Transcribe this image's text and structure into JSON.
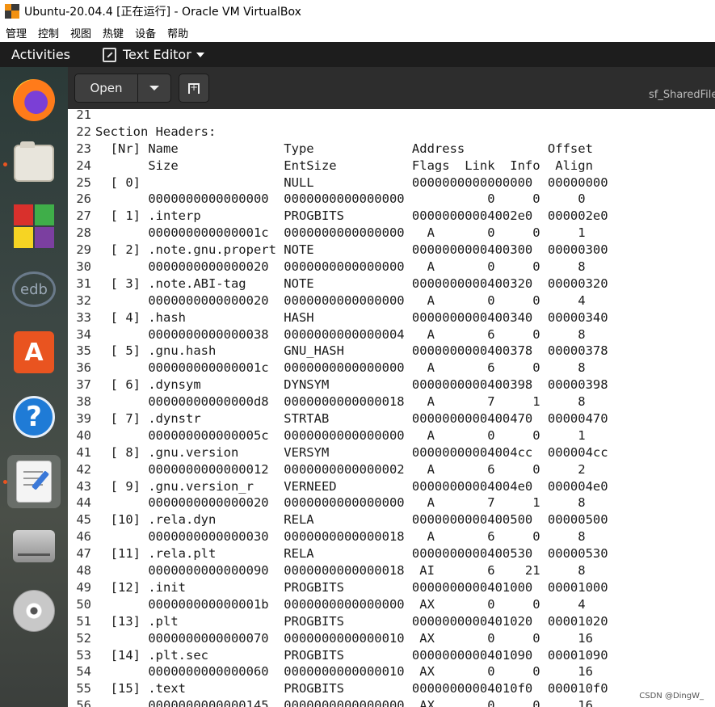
{
  "window": {
    "title": "Ubuntu-20.04.4 [正在运行] - Oracle VM VirtualBox",
    "menu": [
      "管理",
      "控制",
      "视图",
      "热键",
      "设备",
      "帮助"
    ]
  },
  "topbar": {
    "activities": "Activities",
    "app_name": "Text Editor"
  },
  "dock": [
    {
      "name": "firefox-icon"
    },
    {
      "name": "files-icon"
    },
    {
      "name": "libreoffice-icon"
    },
    {
      "name": "edb-icon",
      "text": "edb"
    },
    {
      "name": "software-store-icon"
    },
    {
      "name": "help-icon"
    },
    {
      "name": "text-editor-icon"
    },
    {
      "name": "drive-icon"
    },
    {
      "name": "cdrom-icon"
    }
  ],
  "editor": {
    "open_label": "Open",
    "tab_label": "sf_SharedFile",
    "lines": [
      {
        "n": "21",
        "t": ""
      },
      {
        "n": "22",
        "t": "Section Headers:"
      },
      {
        "n": "23",
        "t": "  [Nr] Name              Type             Address           Offset"
      },
      {
        "n": "24",
        "t": "       Size              EntSize          Flags  Link  Info  Align"
      },
      {
        "n": "25",
        "t": "  [ 0]                   NULL             0000000000000000  00000000"
      },
      {
        "n": "26",
        "t": "       0000000000000000  0000000000000000           0     0     0"
      },
      {
        "n": "27",
        "t": "  [ 1] .interp           PROGBITS         00000000004002e0  000002e0"
      },
      {
        "n": "28",
        "t": "       000000000000001c  0000000000000000   A       0     0     1"
      },
      {
        "n": "29",
        "t": "  [ 2] .note.gnu.propert NOTE             0000000000400300  00000300"
      },
      {
        "n": "30",
        "t": "       0000000000000020  0000000000000000   A       0     0     8"
      },
      {
        "n": "31",
        "t": "  [ 3] .note.ABI-tag     NOTE             0000000000400320  00000320"
      },
      {
        "n": "32",
        "t": "       0000000000000020  0000000000000000   A       0     0     4"
      },
      {
        "n": "33",
        "t": "  [ 4] .hash             HASH             0000000000400340  00000340"
      },
      {
        "n": "34",
        "t": "       0000000000000038  0000000000000004   A       6     0     8"
      },
      {
        "n": "35",
        "t": "  [ 5] .gnu.hash         GNU_HASH         0000000000400378  00000378"
      },
      {
        "n": "36",
        "t": "       000000000000001c  0000000000000000   A       6     0     8"
      },
      {
        "n": "37",
        "t": "  [ 6] .dynsym           DYNSYM           0000000000400398  00000398"
      },
      {
        "n": "38",
        "t": "       00000000000000d8  0000000000000018   A       7     1     8"
      },
      {
        "n": "39",
        "t": "  [ 7] .dynstr           STRTAB           0000000000400470  00000470"
      },
      {
        "n": "40",
        "t": "       000000000000005c  0000000000000000   A       0     0     1"
      },
      {
        "n": "41",
        "t": "  [ 8] .gnu.version      VERSYM           00000000004004cc  000004cc"
      },
      {
        "n": "42",
        "t": "       0000000000000012  0000000000000002   A       6     0     2"
      },
      {
        "n": "43",
        "t": "  [ 9] .gnu.version_r    VERNEED          00000000004004e0  000004e0"
      },
      {
        "n": "44",
        "t": "       0000000000000020  0000000000000000   A       7     1     8"
      },
      {
        "n": "45",
        "t": "  [10] .rela.dyn         RELA             0000000000400500  00000500"
      },
      {
        "n": "46",
        "t": "       0000000000000030  0000000000000018   A       6     0     8"
      },
      {
        "n": "47",
        "t": "  [11] .rela.plt         RELA             0000000000400530  00000530"
      },
      {
        "n": "48",
        "t": "       0000000000000090  0000000000000018  AI       6    21     8"
      },
      {
        "n": "49",
        "t": "  [12] .init             PROGBITS         0000000000401000  00001000"
      },
      {
        "n": "50",
        "t": "       000000000000001b  0000000000000000  AX       0     0     4"
      },
      {
        "n": "51",
        "t": "  [13] .plt              PROGBITS         0000000000401020  00001020"
      },
      {
        "n": "52",
        "t": "       0000000000000070  0000000000000010  AX       0     0     16"
      },
      {
        "n": "53",
        "t": "  [14] .plt.sec          PROGBITS         0000000000401090  00001090"
      },
      {
        "n": "54",
        "t": "       0000000000000060  0000000000000010  AX       0     0     16"
      },
      {
        "n": "55",
        "t": "  [15] .text             PROGBITS         00000000004010f0  000010f0"
      },
      {
        "n": "56",
        "t": "       0000000000000145  0000000000000000  AX       0     0     16"
      }
    ]
  },
  "watermark": "CSDN @DingW_"
}
